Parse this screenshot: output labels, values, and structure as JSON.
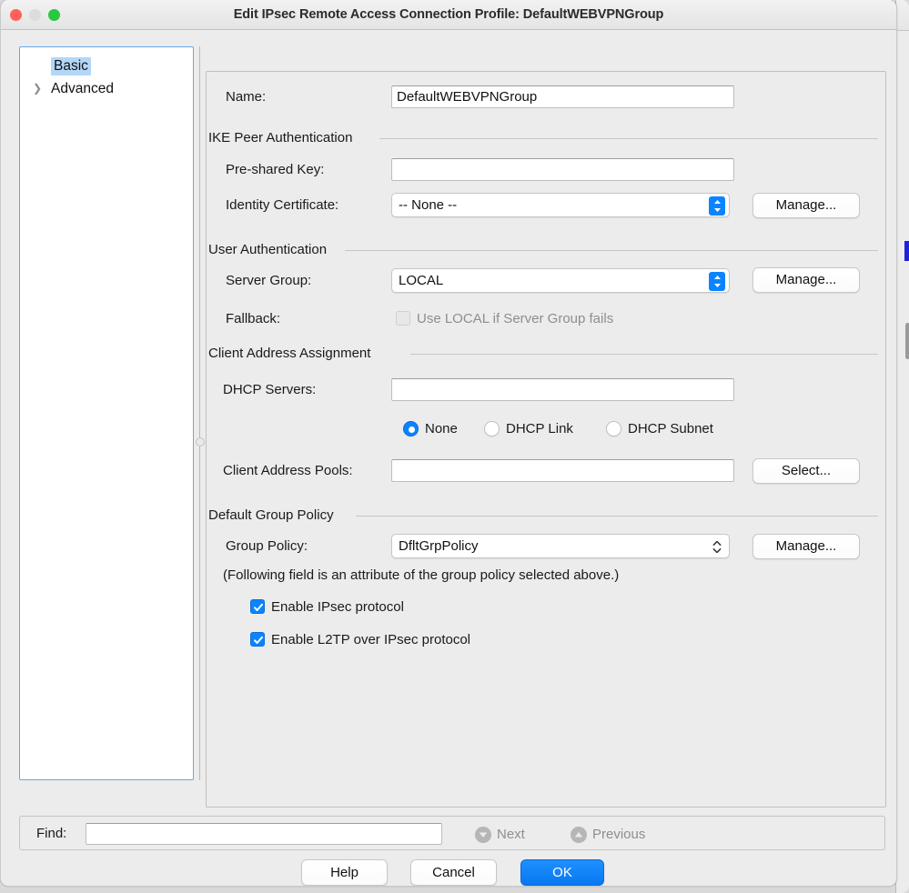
{
  "window": {
    "title": "Edit IPsec Remote Access Connection Profile: DefaultWEBVPNGroup",
    "traffic_lights": [
      "close-button",
      "minimize-button",
      "maximize-button"
    ],
    "accent_color": "#0a84ff",
    "panel_bg": "#ececec",
    "selection_color": "#b3d7f7"
  },
  "sidebar": {
    "items": [
      {
        "label": "Basic",
        "selected": true,
        "expandable": false
      },
      {
        "label": "Advanced",
        "selected": false,
        "expandable": true,
        "chevron": "chevron-right-icon"
      }
    ]
  },
  "form": {
    "name": {
      "label": "Name:",
      "value": "DefaultWEBVPNGroup",
      "placeholder": ""
    },
    "sections": [
      {
        "title": "IKE Peer Authentication"
      },
      {
        "title": "User Authentication"
      },
      {
        "title": "Client Address Assignment"
      },
      {
        "title": "Default Group Policy"
      }
    ],
    "pre_shared_key": {
      "label": "Pre-shared Key:",
      "value": "",
      "placeholder": ""
    },
    "identity_certificate": {
      "label": "Identity Certificate:",
      "value": "-- None --",
      "options": [
        "-- None --"
      ],
      "button": "Manage..."
    },
    "server_group": {
      "label": "Server Group:",
      "value": "LOCAL",
      "options": [
        "LOCAL"
      ],
      "button": "Manage..."
    },
    "fallback": {
      "label": "Fallback:",
      "checkbox_label": "Use LOCAL if Server Group fails",
      "checked": false,
      "enabled": false
    },
    "dhcp_servers": {
      "label": "DHCP Servers:",
      "value": "",
      "placeholder": ""
    },
    "dhcp_mode": {
      "options": [
        {
          "label": "None",
          "selected": true
        },
        {
          "label": "DHCP Link",
          "selected": false
        },
        {
          "label": "DHCP Subnet",
          "selected": false
        }
      ]
    },
    "client_address_pools": {
      "label": "Client Address Pools:",
      "value": "",
      "placeholder": "",
      "button": "Select..."
    },
    "group_policy": {
      "label": "Group Policy:",
      "value": "DfltGrpPolicy",
      "options": [
        "DfltGrpPolicy"
      ],
      "button": "Manage..."
    },
    "group_policy_note": "(Following field is an attribute of the group policy selected above.)",
    "protocol_checkboxes": [
      {
        "label": "Enable IPsec protocol",
        "checked": true
      },
      {
        "label": "Enable L2TP over IPsec protocol",
        "checked": true
      }
    ]
  },
  "find_bar": {
    "label": "Find:",
    "value": "",
    "placeholder": "",
    "next": {
      "label": "Next",
      "icon": "arrow-down-circle-icon",
      "enabled": false
    },
    "previous": {
      "label": "Previous",
      "icon": "arrow-up-circle-icon",
      "enabled": false
    }
  },
  "footer": {
    "help": "Help",
    "cancel": "Cancel",
    "ok": "OK"
  }
}
